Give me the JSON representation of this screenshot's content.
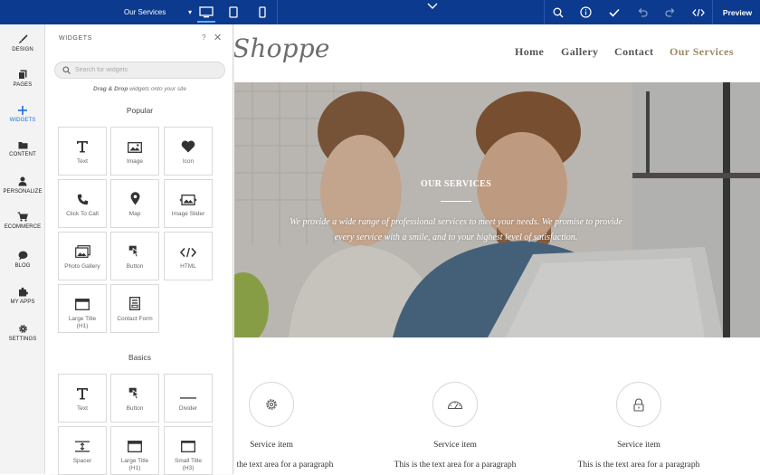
{
  "topbar": {
    "page_select": "Our Services",
    "devices": [
      "desktop-icon",
      "tablet-icon",
      "mobile-icon"
    ],
    "actions": [
      "search-icon",
      "info-icon",
      "check-icon",
      "undo-icon",
      "redo-icon",
      "code-icon"
    ],
    "preview_label": "Preview",
    "colors": {
      "bar": "#0b3a8f",
      "active": "#5fb3ff"
    }
  },
  "leftnav": {
    "items": [
      {
        "label": "DESIGN",
        "icon": "brush-icon"
      },
      {
        "label": "PAGES",
        "icon": "pages-icon"
      },
      {
        "label": "WIDGETS",
        "icon": "plus-icon",
        "active": true
      },
      {
        "label": "CONTENT",
        "icon": "folder-icon"
      },
      {
        "label": "PERSONALIZE",
        "icon": "person-icon"
      },
      {
        "label": "ECOMMERCE",
        "icon": "cart-icon"
      },
      {
        "label": "BLOG",
        "icon": "chat-icon"
      },
      {
        "label": "MY APPS",
        "icon": "puzzle-icon"
      },
      {
        "label": "SETTINGS",
        "icon": "gear-icon"
      }
    ]
  },
  "panel": {
    "title": "WIDGETS",
    "help": "?",
    "close": "✕",
    "search_placeholder": "Search for widgets",
    "hint_bold": "Drag & Drop",
    "hint_rest": " widgets onto your site",
    "popular_title": "Popular",
    "popular": [
      {
        "label": "Text",
        "icon": "text-icon"
      },
      {
        "label": "Image",
        "icon": "image-icon"
      },
      {
        "label": "Icon",
        "icon": "heart-icon"
      },
      {
        "label": "Click To Call",
        "icon": "phone-icon"
      },
      {
        "label": "Map",
        "icon": "map-pin-icon"
      },
      {
        "label": "Image Slider",
        "icon": "image-slider-icon"
      },
      {
        "label": "Photo Gallery",
        "icon": "photo-gallery-icon"
      },
      {
        "label": "Button",
        "icon": "pointer-icon"
      },
      {
        "label": "HTML",
        "icon": "html-code-icon"
      },
      {
        "label": "Large Title (H1)",
        "icon": "large-title-icon"
      },
      {
        "label": "Contact Form",
        "icon": "contact-form-icon"
      }
    ],
    "basics_title": "Basics",
    "basics": [
      {
        "label": "Text",
        "icon": "text-icon"
      },
      {
        "label": "Button",
        "icon": "pointer-icon"
      },
      {
        "label": "Divider",
        "icon": "divider-icon"
      },
      {
        "label": "Spacer",
        "icon": "spacer-icon"
      },
      {
        "label": "Large Title (H1)",
        "icon": "large-title-icon"
      },
      {
        "label": "Small Title (H3)",
        "icon": "small-title-icon"
      }
    ]
  },
  "site": {
    "logo": "Shoppe",
    "nav": [
      "Home",
      "Gallery",
      "Contact",
      "Our Services"
    ],
    "nav_active_color": "#9b8a63",
    "hero": {
      "title": "OUR SERVICES",
      "text": "We provide a wide range of professional services to meet your needs. We promise to provide every service with a smile, and to your highest level of satisfaction."
    },
    "services": [
      {
        "icon": "gear-icon",
        "title": "Service item",
        "text": "This is the text area for a paragraph"
      },
      {
        "icon": "speedometer-icon",
        "title": "Service item",
        "text": "This is the text area for a paragraph"
      },
      {
        "icon": "lock-icon",
        "title": "Service item",
        "text": "This is the text area for a paragraph"
      }
    ]
  }
}
